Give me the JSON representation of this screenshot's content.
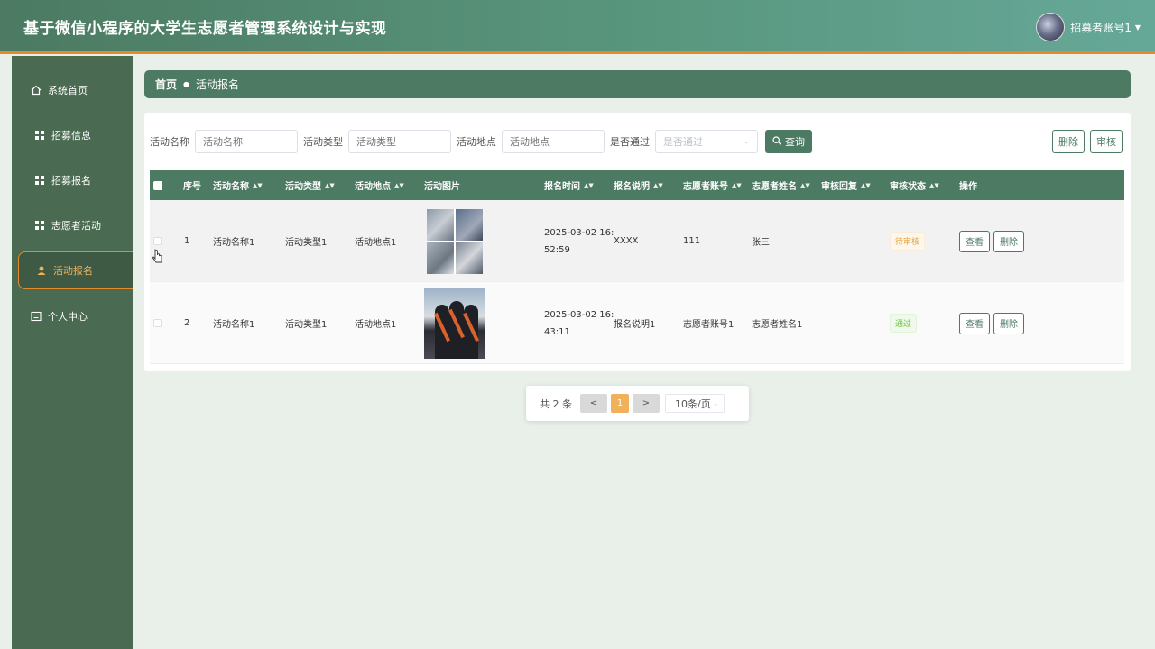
{
  "header": {
    "title": "基于微信小程序的大学生志愿者管理系统设计与实现",
    "user_name": "招募者账号1"
  },
  "sidebar": {
    "items": [
      {
        "label": "系统首页",
        "icon": "home-icon"
      },
      {
        "label": "招募信息",
        "icon": "grid-icon"
      },
      {
        "label": "招募报名",
        "icon": "grid-icon"
      },
      {
        "label": "志愿者活动",
        "icon": "grid-icon"
      },
      {
        "label": "活动报名",
        "icon": "user-icon",
        "active": true
      },
      {
        "label": "个人中心",
        "icon": "profile-icon"
      }
    ]
  },
  "breadcrumb": {
    "home": "首页",
    "current": "活动报名"
  },
  "search": {
    "fields": [
      {
        "label": "活动名称",
        "placeholder": "活动名称"
      },
      {
        "label": "活动类型",
        "placeholder": "活动类型"
      },
      {
        "label": "活动地点",
        "placeholder": "活动地点"
      },
      {
        "label": "是否通过",
        "placeholder": "是否通过"
      }
    ],
    "search_label": "查询",
    "delete_label": "删除",
    "audit_label": "审核"
  },
  "table": {
    "headers": [
      "序号",
      "活动名称",
      "活动类型",
      "活动地点",
      "活动图片",
      "报名时间",
      "报名说明",
      "志愿者账号",
      "志愿者姓名",
      "审核回复",
      "审核状态",
      "操作"
    ],
    "rows": [
      {
        "index": "1",
        "name": "活动名称1",
        "type": "活动类型1",
        "place": "活动地点1",
        "time": "2025-03-02 16:52:59",
        "desc": "XXXX",
        "account": "111",
        "volunteer": "张三",
        "reply": "",
        "status": "待审核",
        "status_kind": "wait"
      },
      {
        "index": "2",
        "name": "活动名称1",
        "type": "活动类型1",
        "place": "活动地点1",
        "time": "2025-03-02 16:43:11",
        "desc": "报名说明1",
        "account": "志愿者账号1",
        "volunteer": "志愿者姓名1",
        "reply": "",
        "status": "通过",
        "status_kind": "pass"
      }
    ],
    "view_label": "查看",
    "delete_label": "删除"
  },
  "pagination": {
    "total": "共 2 条",
    "prev": "<",
    "page": "1",
    "next": ">",
    "page_size": "10条/页"
  },
  "colors": {
    "primary": "#4c7a62",
    "accent": "#e58a2c",
    "page_active": "#f0b15a",
    "sidebar": "#4a6a51"
  }
}
